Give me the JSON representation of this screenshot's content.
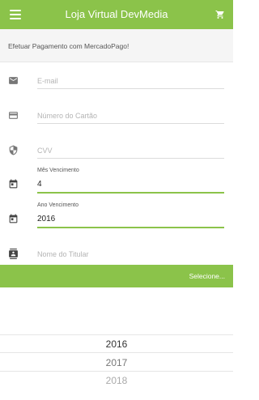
{
  "app": {
    "title": "Loja Virtual DevMedia"
  },
  "subheader": {
    "text": "Efetuar Pagamento com MercadoPago!"
  },
  "form": {
    "email_placeholder": "E-mail",
    "card_placeholder": "Número do Cartão",
    "cvv_placeholder": "CVV",
    "month_label": "Mês Vencimento",
    "month_value": "4",
    "year_label": "Ano Vencimento",
    "year_value": "2016",
    "holder_placeholder": "Nome do Titular"
  },
  "select_button": {
    "label": "Selecione..."
  },
  "picker": {
    "options": [
      "2016",
      "2017",
      "2018"
    ]
  },
  "colors": {
    "accent": "#8bc34a",
    "icon": "#777777"
  }
}
